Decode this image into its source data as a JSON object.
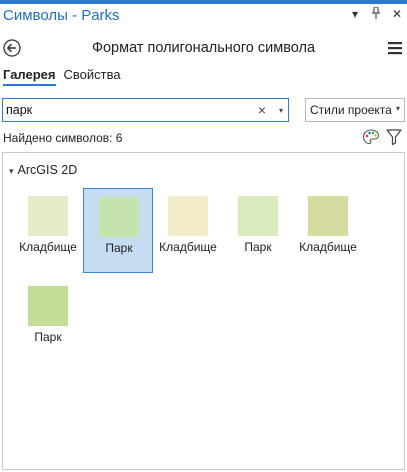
{
  "pane": {
    "title": "Символы - Parks",
    "controls": [
      "▾",
      "ᵖ",
      "✕"
    ]
  },
  "header": {
    "title": "Формат полигонального символа"
  },
  "tabs": [
    {
      "label": "Галерея",
      "active": true
    },
    {
      "label": "Свойства",
      "active": false
    }
  ],
  "search": {
    "value": "парк",
    "clear": "×",
    "caret": "▾"
  },
  "styles_select": {
    "value": "Стили проекта",
    "caret": "▾"
  },
  "found": {
    "text": "Найдено символов: 6"
  },
  "gallery": {
    "group": {
      "chevron": "▾",
      "label": "ArcGIS 2D"
    },
    "items": [
      {
        "label": "Кладбище",
        "color": "#e6ecc9",
        "selected": false
      },
      {
        "label": "Парк",
        "color": "#c6e2ad",
        "selected": true
      },
      {
        "label": "Кладбище",
        "color": "#f2ecc8",
        "selected": false
      },
      {
        "label": "Парк",
        "color": "#d9ebbd",
        "selected": false
      },
      {
        "label": "Кладбище",
        "color": "#d6db9f",
        "selected": false
      },
      {
        "label": "Парк",
        "color": "#c3dd96",
        "selected": false
      }
    ]
  },
  "colors": {
    "accent": "#2b79d0",
    "title": "#1f6fc5",
    "selection_bg": "#c6dcf1",
    "selection_border": "#3b84cf"
  }
}
